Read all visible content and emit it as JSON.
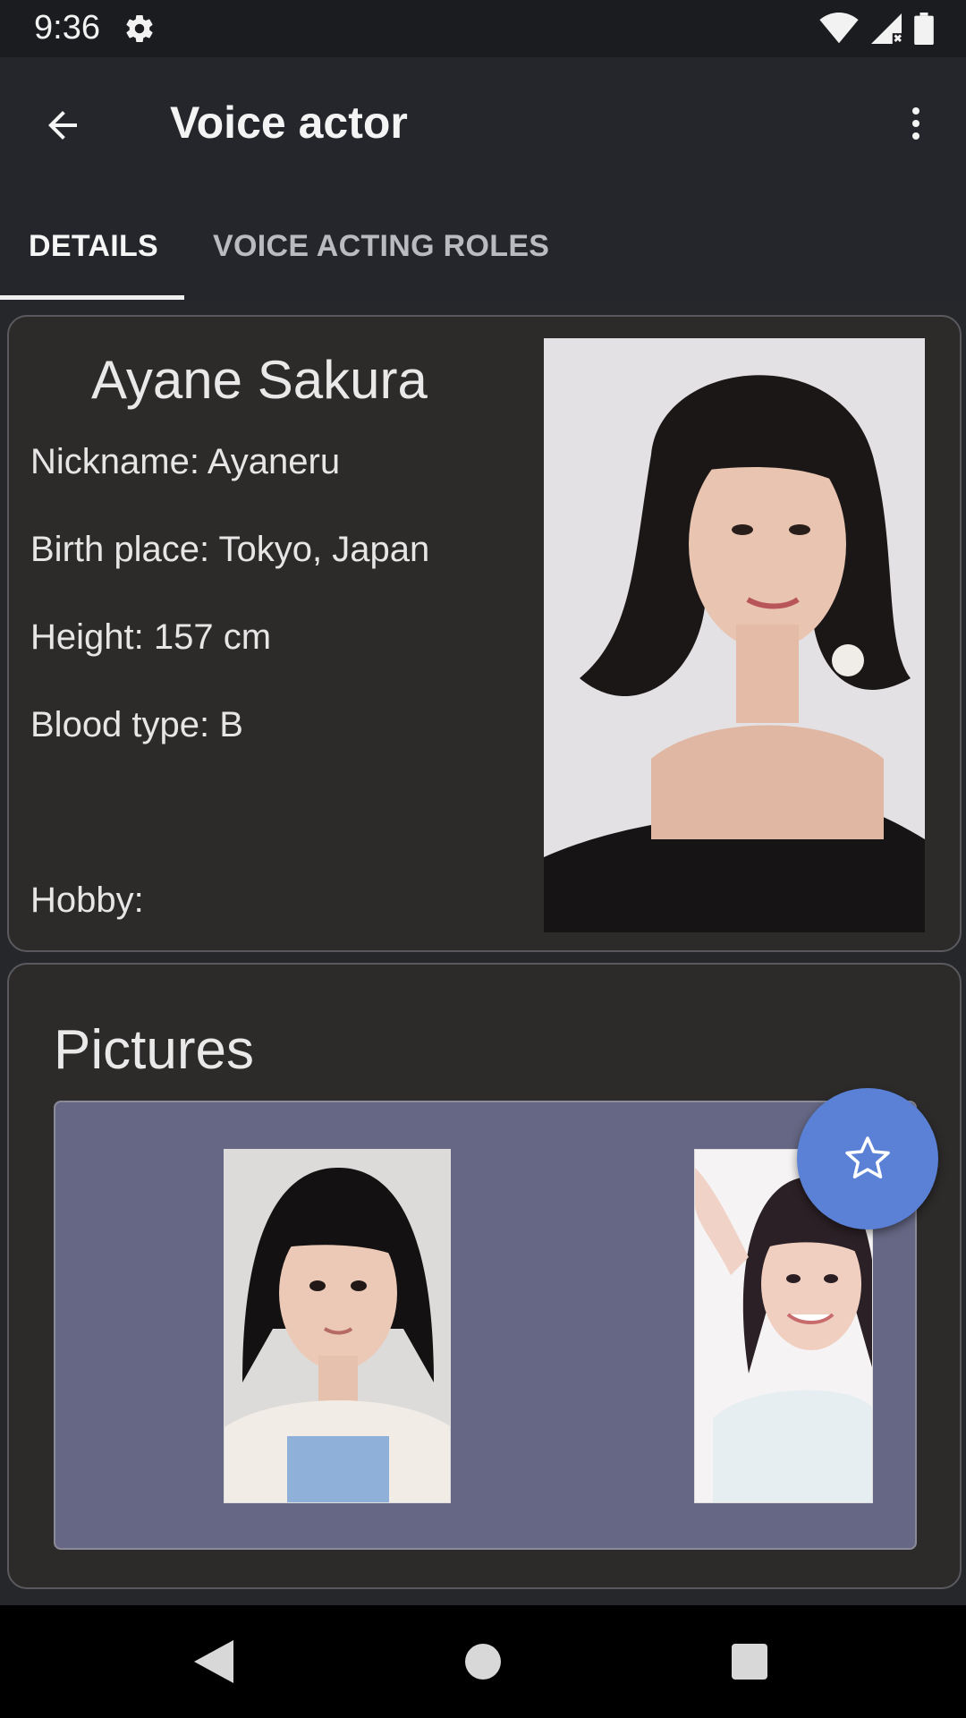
{
  "status_bar": {
    "time": "9:36",
    "icons": [
      "gear-icon",
      "wifi-icon",
      "cell-signal-icon",
      "battery-icon"
    ]
  },
  "app_bar": {
    "title": "Voice actor",
    "back_icon": "arrow-back-icon",
    "menu_icon": "more-vert-icon"
  },
  "tabs": [
    {
      "label": "DETAILS",
      "selected": true
    },
    {
      "label": "VOICE ACTING ROLES",
      "selected": false
    }
  ],
  "details": {
    "name": "Ayane Sakura",
    "nickname": "Nickname: Ayaneru",
    "birth_place": "Birth place: Tokyo, Japan",
    "height": "Height: 157 cm",
    "blood_type": "Blood type: B",
    "hobby": "Hobby:"
  },
  "fab": {
    "icon": "star-outline-icon",
    "color": "#5a81d6"
  },
  "pictures": {
    "title": "Pictures",
    "count": 2
  },
  "nav_bar": {
    "icons": [
      "back-triangle-icon",
      "home-circle-icon",
      "recents-square-icon"
    ]
  },
  "colors": {
    "background": "#26272b",
    "card": "#2d2b2a",
    "gallery": "#666784",
    "accent": "#5a81d6"
  }
}
